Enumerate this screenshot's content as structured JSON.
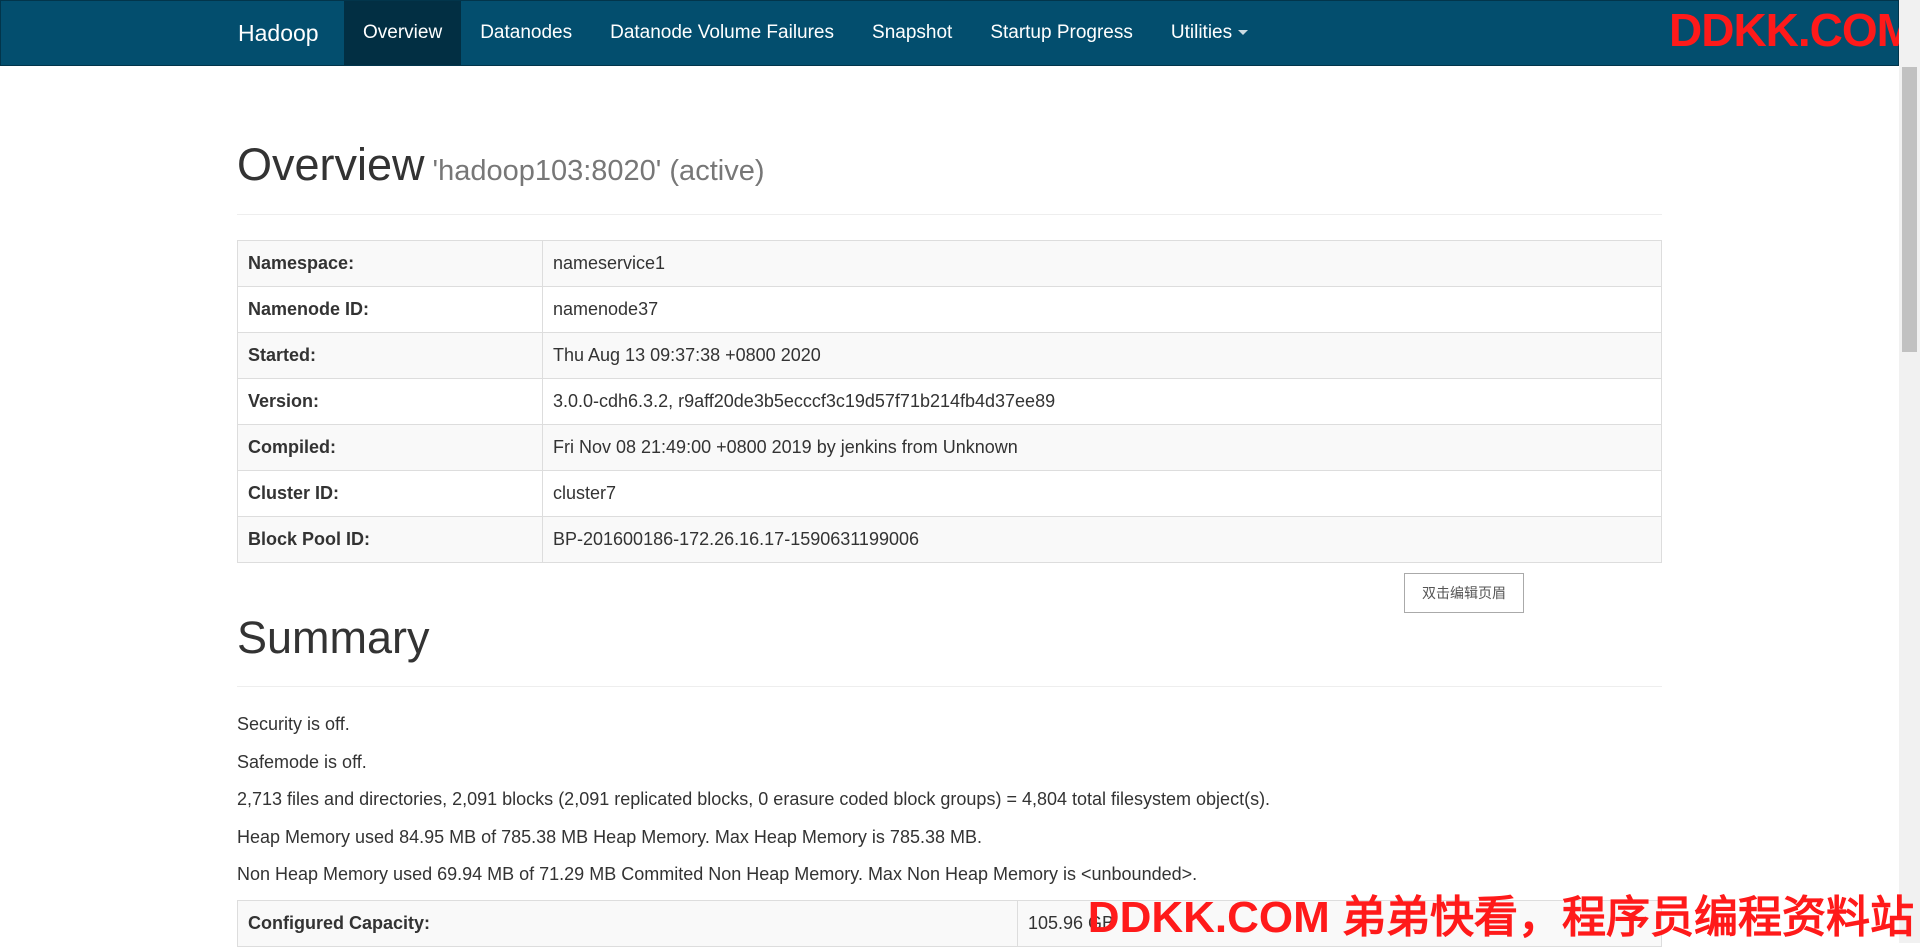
{
  "navbar": {
    "brand": "Hadoop",
    "items": [
      {
        "label": "Overview",
        "active": true
      },
      {
        "label": "Datanodes"
      },
      {
        "label": "Datanode Volume Failures"
      },
      {
        "label": "Snapshot"
      },
      {
        "label": "Startup Progress"
      },
      {
        "label": "Utilities"
      }
    ]
  },
  "watermark": {
    "top": "DDKK.COM",
    "bottom": "DDKK.COM 弟弟快看，程序员编程资料站"
  },
  "overview": {
    "title": "Overview",
    "subtitle": "'hadoop103:8020' (active)",
    "rows": [
      {
        "key": "Namespace:",
        "value": "nameservice1"
      },
      {
        "key": "Namenode ID:",
        "value": "namenode37"
      },
      {
        "key": "Started:",
        "value": "Thu Aug 13 09:37:38 +0800 2020"
      },
      {
        "key": "Version:",
        "value": "3.0.0-cdh6.3.2, r9aff20de3b5ecccf3c19d57f71b214fb4d37ee89"
      },
      {
        "key": "Compiled:",
        "value": "Fri Nov 08 21:49:00 +0800 2019 by jenkins from Unknown"
      },
      {
        "key": "Cluster ID:",
        "value": "cluster7"
      },
      {
        "key": "Block Pool ID:",
        "value": "BP-201600186-172.26.16.17-1590631199006"
      }
    ]
  },
  "edit_header_button": "双击编辑页眉",
  "summary": {
    "title": "Summary",
    "lines": [
      "Security is off.",
      "Safemode is off.",
      "2,713 files and directories, 2,091 blocks (2,091 replicated blocks, 0 erasure coded block groups) = 4,804 total filesystem object(s).",
      "Heap Memory used 84.95 MB of 785.38 MB Heap Memory. Max Heap Memory is 785.38 MB.",
      "Non Heap Memory used 69.94 MB of 71.29 MB Commited Non Heap Memory. Max Non Heap Memory is <unbounded>."
    ],
    "capacity": {
      "key": "Configured Capacity:",
      "value": "105.96 GB"
    }
  }
}
